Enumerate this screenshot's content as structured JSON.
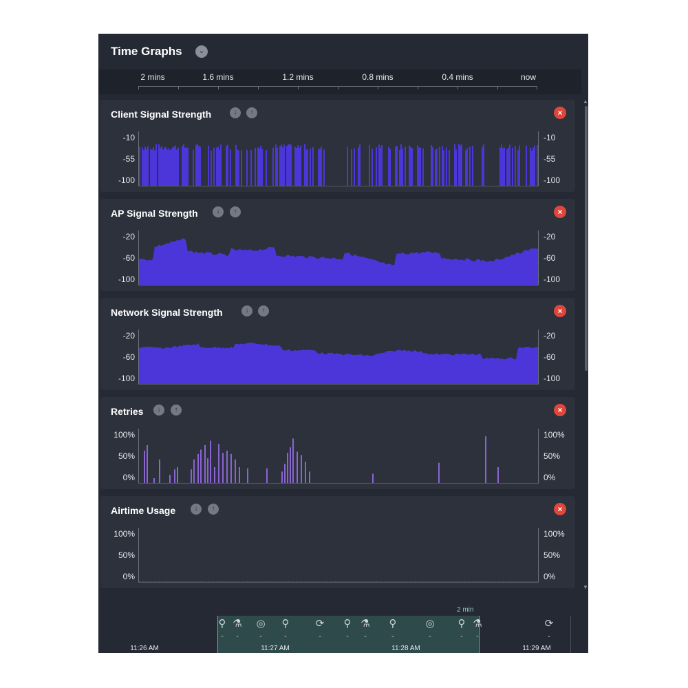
{
  "header": {
    "title": "Time Graphs",
    "chevron_icon": "chevron-down-icon"
  },
  "time_axis": {
    "labels": [
      "2 mins",
      "1.6 mins",
      "1.2 mins",
      "0.8 mins",
      "0.4 mins",
      "now"
    ]
  },
  "panels": [
    {
      "title": "Client Signal Strength",
      "y_labels": [
        "-10",
        "-55",
        "-100"
      ],
      "type": "client"
    },
    {
      "title": "AP Signal Strength",
      "y_labels": [
        "-20",
        "-60",
        "-100"
      ],
      "type": "ap"
    },
    {
      "title": "Network Signal Strength",
      "y_labels": [
        "-20",
        "-60",
        "-100"
      ],
      "type": "network"
    },
    {
      "title": "Retries",
      "y_labels": [
        "100%",
        "50%",
        "0%"
      ],
      "type": "retries"
    },
    {
      "title": "Airtime Usage",
      "y_labels": [
        "100%",
        "50%",
        "0%"
      ],
      "type": "airtime"
    }
  ],
  "timeline": {
    "span_label": "2 min",
    "times": [
      "11:26 AM",
      "11:27 AM",
      "11:28 AM",
      "11:29 AM"
    ]
  },
  "colors": {
    "bar": "#4c36d9",
    "retry_bar": "#8b64d4",
    "close": "#e0473c",
    "window": "#2f4a4b"
  }
}
